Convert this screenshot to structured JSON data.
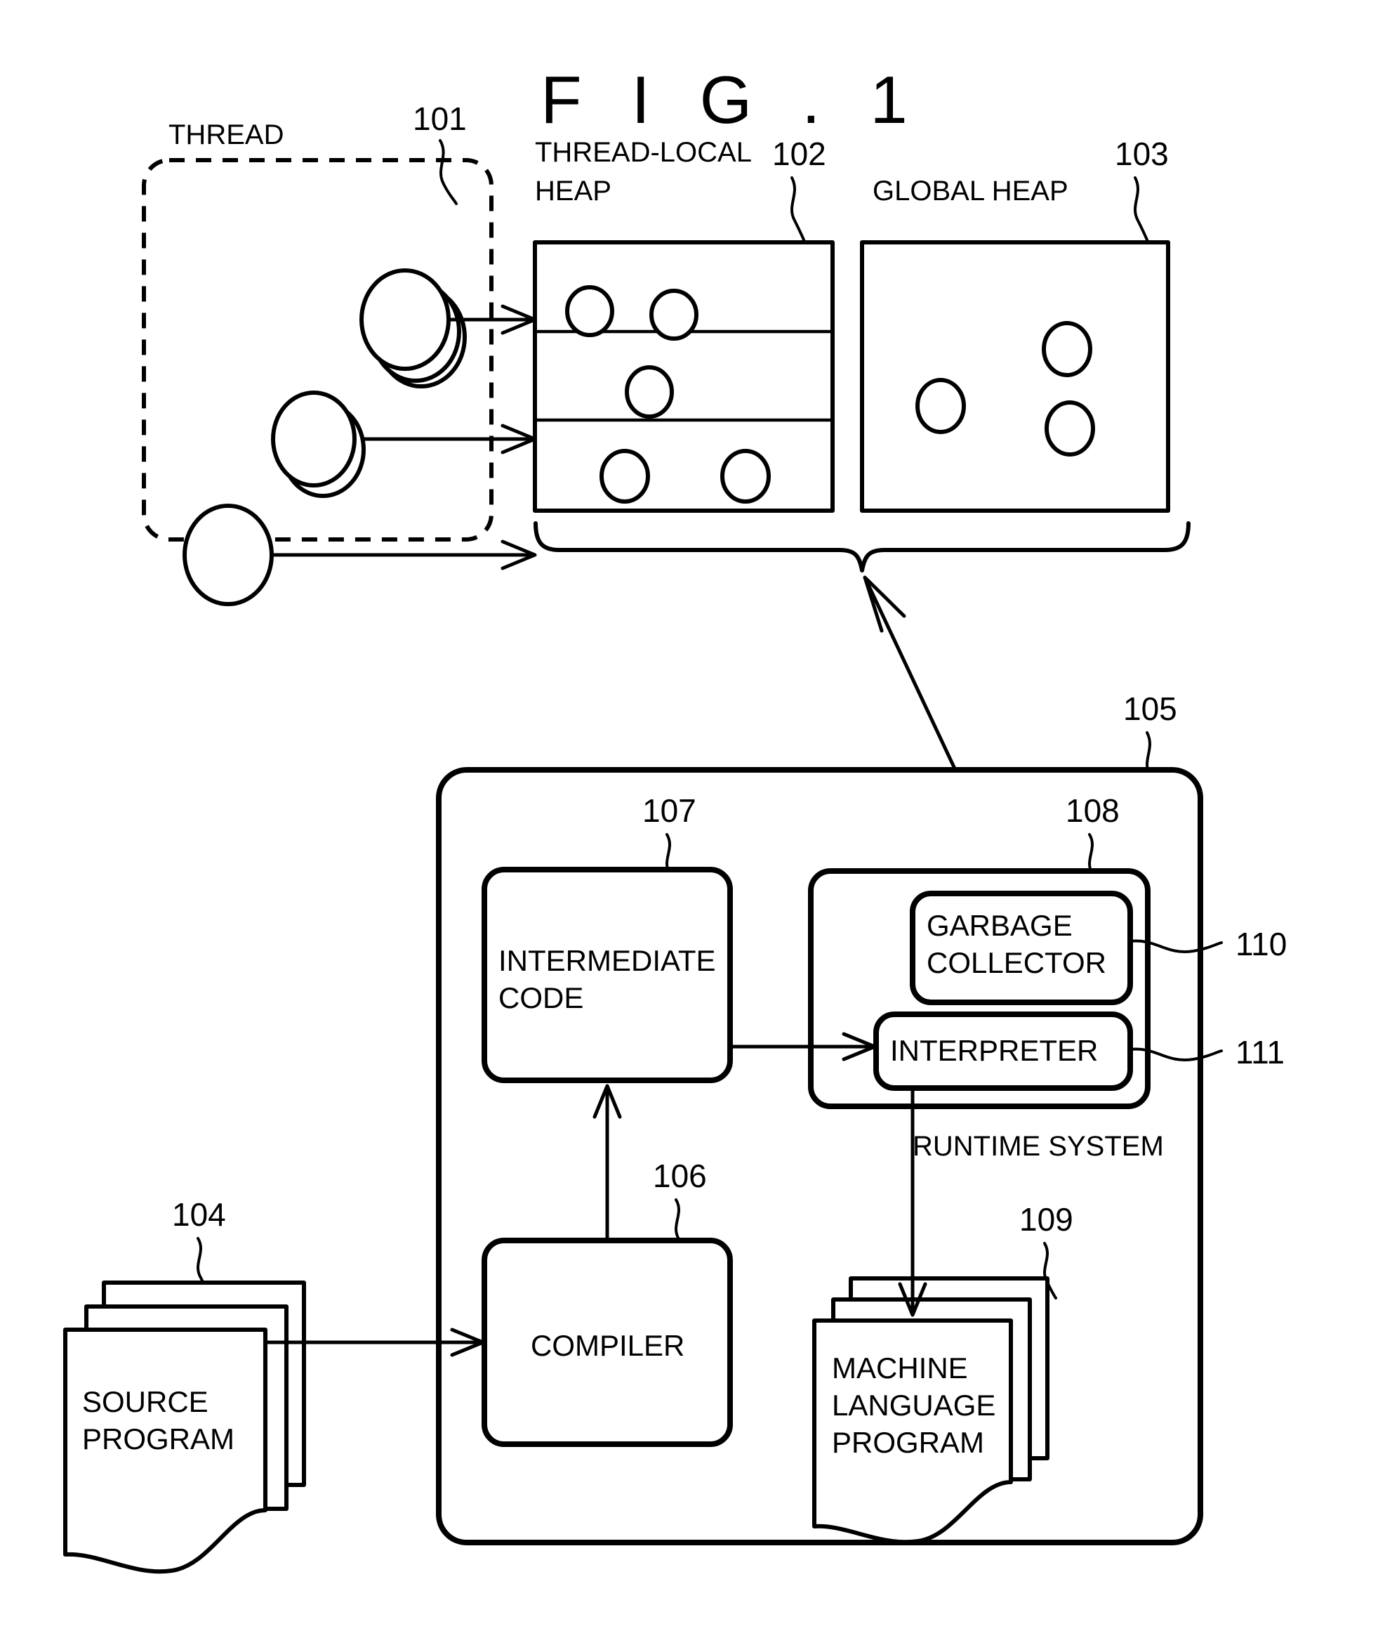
{
  "figure": {
    "title": "F I G . 1"
  },
  "labels": {
    "thread": "THREAD",
    "thread_local_heap_line1": "THREAD-LOCAL",
    "thread_local_heap_line2": "HEAP",
    "global_heap": "GLOBAL HEAP",
    "runtime_system": "RUNTIME SYSTEM"
  },
  "reference_numerals": {
    "n101": "101",
    "n102": "102",
    "n103": "103",
    "n104": "104",
    "n105": "105",
    "n106": "106",
    "n107": "107",
    "n108": "108",
    "n109": "109",
    "n110": "110",
    "n111": "111"
  },
  "blocks": {
    "intermediate_code_line1": "INTERMEDIATE",
    "intermediate_code_line2": "CODE",
    "garbage_collector_line1": "GARBAGE",
    "garbage_collector_line2": "COLLECTOR",
    "interpreter": "INTERPRETER",
    "compiler": "COMPILER",
    "source_program_line1": "SOURCE",
    "source_program_line2": "PROGRAM",
    "machine_language_program_line1": "MACHINE",
    "machine_language_program_line2": "LANGUAGE",
    "machine_language_program_line3": "PROGRAM"
  },
  "colors": {
    "ink": "#000000",
    "paper": "#ffffff"
  },
  "structure": {
    "thread_objects_count": 3,
    "thread_local_heap_rows": 3,
    "thread_local_heap_row_objects": [
      2,
      1,
      2
    ],
    "global_heap_objects": 3
  }
}
